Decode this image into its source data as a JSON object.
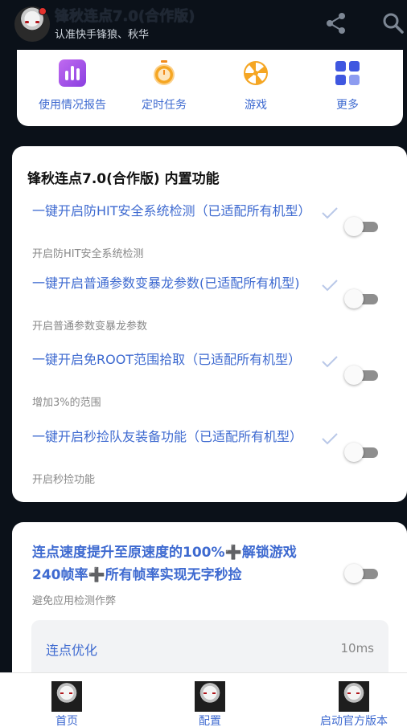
{
  "header": {
    "title": "锋秋连点7.0(合作版)",
    "subtitle": "认准快手锋狼、秋华",
    "share_icon": "share-icon",
    "search_icon": "search-icon"
  },
  "shortcuts": [
    {
      "label": "使用情况报告",
      "icon": "bar-chart-icon",
      "color": "#a14be8"
    },
    {
      "label": "定时任务",
      "icon": "stopwatch-icon",
      "color": "#f28b1c"
    },
    {
      "label": "游戏",
      "icon": "pinwheel-icon",
      "color": "#f5a623"
    },
    {
      "label": "更多",
      "icon": "grid-icon",
      "color": "#3f57e0"
    }
  ],
  "features": {
    "title": "锋秋连点7.0(合作版) 内置功能",
    "items": [
      {
        "title": "一键开启防HIT安全系统检测（已适配所有机型）",
        "desc": "开启防HIT安全系统检测",
        "enabled": false
      },
      {
        "title": "一键开启普通参数变暴龙参数(已适配所有机型)",
        "desc": "开启普通参数变暴龙参数",
        "enabled": false
      },
      {
        "title": "一键开启免ROOT范围拾取（已适配所有机型）",
        "desc": "增加3%的范围",
        "enabled": false
      },
      {
        "title": "一键开启秒捡队友装备功能（已适配所有机型）",
        "desc": "开启秒捡功能",
        "enabled": false
      }
    ]
  },
  "speed": {
    "title_part1": "连点速度提升至原速度的100%",
    "plus1": "➕",
    "title_part2": "解锁游戏240帧率",
    "plus2": "➕",
    "title_part3": "所有帧率实现无字秒捡",
    "desc": "避免应用检测作弊",
    "enabled": false,
    "option_label": "连点优化",
    "option_value": "10ms"
  },
  "bottom_nav": [
    {
      "label": "首页"
    },
    {
      "label": "配置"
    },
    {
      "label": "启动官方版本"
    }
  ],
  "colors": {
    "accent": "#3e6ad0",
    "background": "#0b1119",
    "plus": "#ff7a1a"
  }
}
